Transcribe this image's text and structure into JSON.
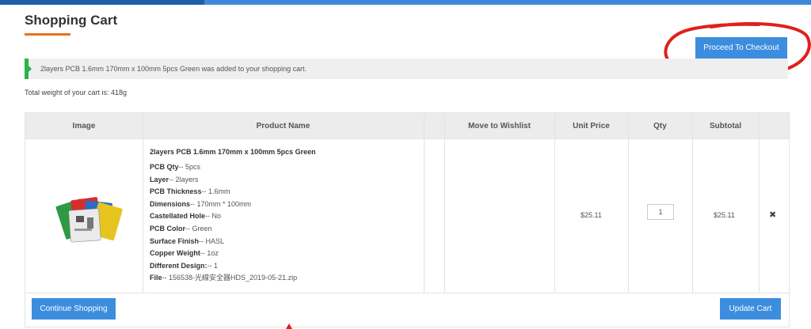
{
  "page": {
    "title": "Shopping Cart",
    "checkout_label": "Proceed To Checkout",
    "notice": "2layers PCB 1.6mm 170mm x 100mm 5pcs Green was added to your shopping cart.",
    "weight_text": "Total weight of your cart is: 418g"
  },
  "table": {
    "headers": [
      "Image",
      "Product Name",
      "Move to Wishlist",
      "Unit Price",
      "Qty",
      "Subtotal"
    ]
  },
  "item": {
    "name": "2layers PCB 1.6mm 170mm x 100mm 5pcs Green",
    "attributes": [
      {
        "label": "PCB Qty",
        "value": "-- 5pcs"
      },
      {
        "label": "Layer",
        "value": "-- 2layers"
      },
      {
        "label": "PCB Thickness",
        "value": "-- 1.6mm"
      },
      {
        "label": "Dimensions",
        "value": "-- 170mm * 100mm"
      },
      {
        "label": "Castellated Hole",
        "value": "-- No"
      },
      {
        "label": "PCB Color",
        "value": "-- Green"
      },
      {
        "label": "Surface Finish",
        "value": "-- HASL"
      },
      {
        "label": "Copper Weight",
        "value": "-- 1oz"
      },
      {
        "label": "Different Design:",
        "value": "-- 1"
      },
      {
        "label": "File",
        "value": "-- 156538-光線安全器HDS_2019-05-21.zip"
      }
    ],
    "unit_price": "$25.11",
    "qty": "1",
    "subtotal": "$25.11",
    "remove_glyph": "✖"
  },
  "actions": {
    "continue_label": "Continue Shopping",
    "update_label": "Update Cart"
  },
  "colors": {
    "accent": "#3c8dde",
    "underline": "#e8731f",
    "success": "#2bb34a",
    "annotation": "#e0201b"
  }
}
